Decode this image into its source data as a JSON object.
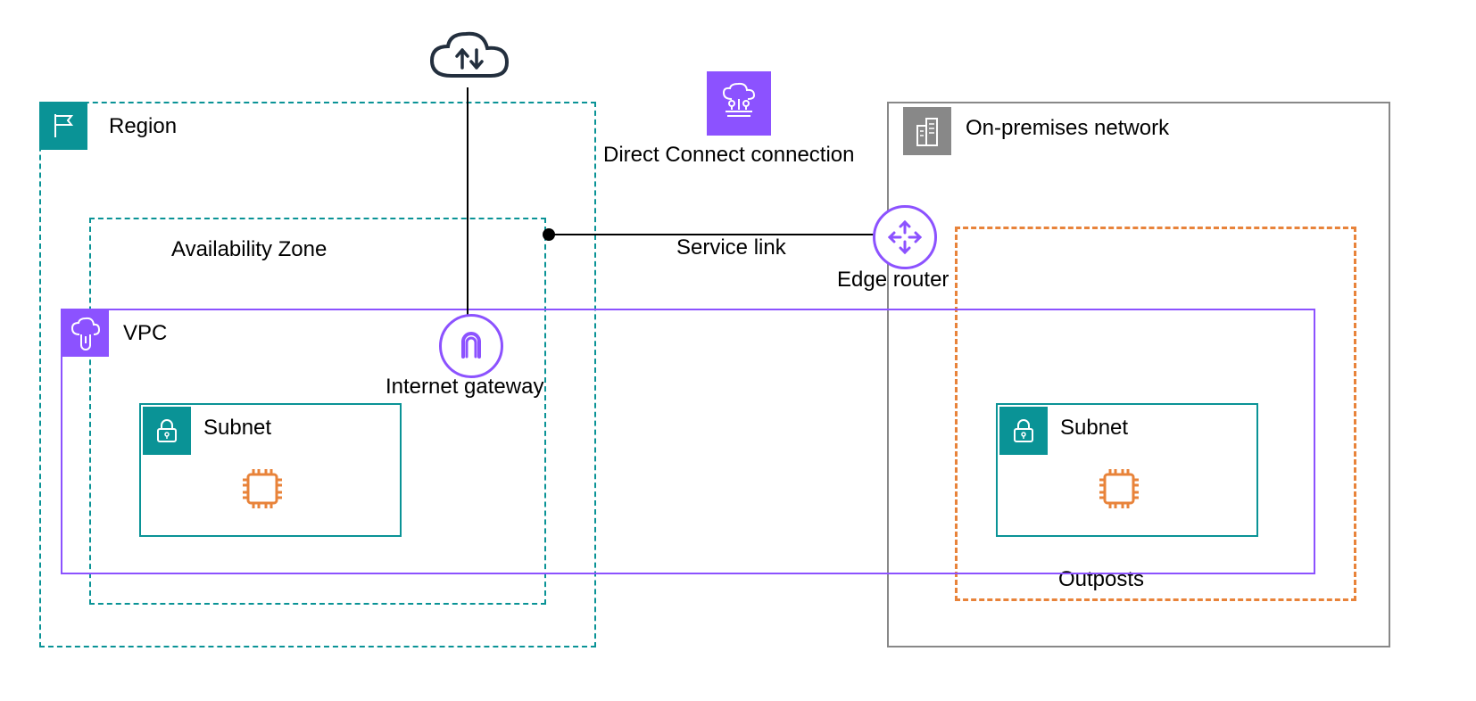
{
  "region": {
    "label": "Region"
  },
  "az": {
    "label": "Availability Zone"
  },
  "vpc": {
    "label": "VPC"
  },
  "subnet_left": {
    "label": "Subnet"
  },
  "subnet_right": {
    "label": "Subnet"
  },
  "onprem": {
    "label": "On-premises network"
  },
  "outposts": {
    "label": "Outposts"
  },
  "igw": {
    "label": "Internet gateway"
  },
  "edge_router": {
    "label": "Edge router"
  },
  "service_link": {
    "label": "Service link"
  },
  "dx": {
    "label": "Direct Connect connection"
  },
  "colors": {
    "teal": "#0a9396",
    "purple": "#8c52ff",
    "orange": "#e8833a",
    "grey": "#888888"
  }
}
